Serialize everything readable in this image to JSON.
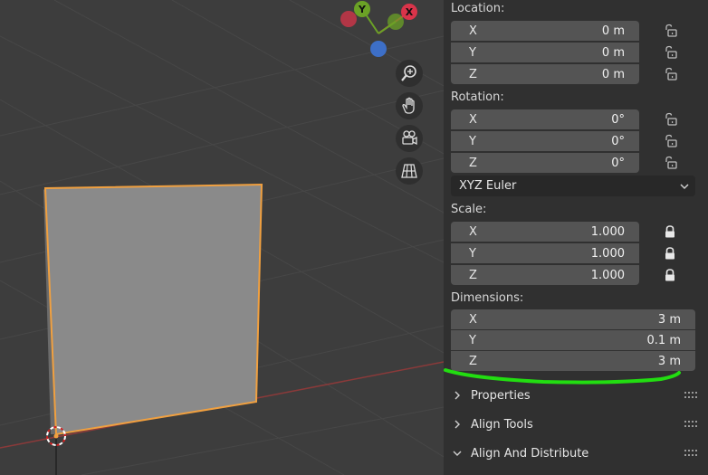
{
  "viewport": {
    "gizmo": {
      "y_label": "Y",
      "x_label": "X"
    }
  },
  "npanel": {
    "location": {
      "label": "Location:",
      "fields": [
        {
          "axis": "X",
          "value": "0 m"
        },
        {
          "axis": "Y",
          "value": "0 m"
        },
        {
          "axis": "Z",
          "value": "0 m"
        }
      ]
    },
    "rotation": {
      "label": "Rotation:",
      "fields": [
        {
          "axis": "X",
          "value": "0°"
        },
        {
          "axis": "Y",
          "value": "0°"
        },
        {
          "axis": "Z",
          "value": "0°"
        }
      ],
      "mode": "XYZ Euler"
    },
    "scale": {
      "label": "Scale:",
      "fields": [
        {
          "axis": "X",
          "value": "1.000"
        },
        {
          "axis": "Y",
          "value": "1.000"
        },
        {
          "axis": "Z",
          "value": "1.000"
        }
      ]
    },
    "dimensions": {
      "label": "Dimensions:",
      "fields": [
        {
          "axis": "X",
          "value": "3 m"
        },
        {
          "axis": "Y",
          "value": "0.1 m"
        },
        {
          "axis": "Z",
          "value": "3 m"
        }
      ]
    },
    "subpanels": [
      {
        "title": "Properties",
        "expanded": false
      },
      {
        "title": "Align Tools",
        "expanded": false
      },
      {
        "title": "Align And Distribute",
        "expanded": true
      }
    ]
  },
  "colors": {
    "selection_outline": "#f0a040",
    "annotation": "#22dd11",
    "gizmo_x": "#d9344a",
    "gizmo_y": "#6ba226",
    "gizmo_z": "#3d6fc7"
  }
}
